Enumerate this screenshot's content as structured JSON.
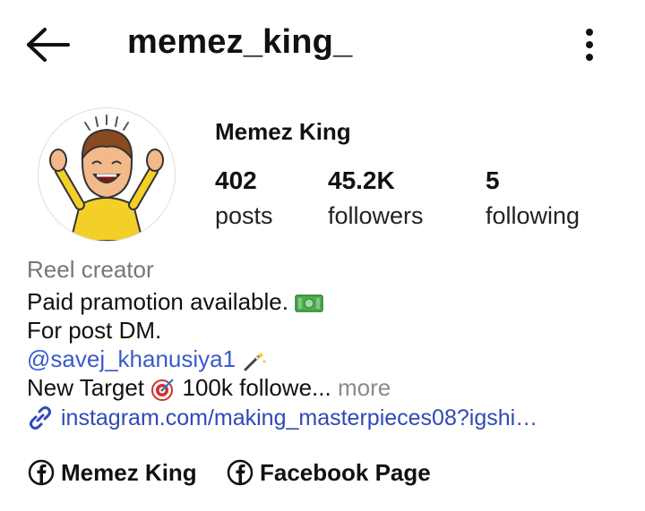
{
  "header": {
    "back_icon": "arrow-left-icon",
    "username": "memez_king_",
    "menu_icon": "more-vertical-icon"
  },
  "profile": {
    "display_name": "Memez King",
    "stats": [
      {
        "value": "402",
        "label": "posts"
      },
      {
        "value": "45.2K",
        "label": "followers"
      },
      {
        "value": "5",
        "label": "following"
      }
    ]
  },
  "bio": {
    "category": "Reel creator",
    "line1": "Paid pramotion available.",
    "line2": "For post DM.",
    "mention": "@savej_khanusiya1",
    "line4_prefix": "New Target",
    "line4_suffix": "100k followe...",
    "more_label": "more",
    "link": "instagram.com/making_masterpieces08?igshi…"
  },
  "linked_pages": [
    {
      "label": "Memez King",
      "icon": "facebook-icon"
    },
    {
      "label": "Facebook Page",
      "icon": "facebook-icon"
    }
  ],
  "colors": {
    "link_blue": "#2f49b8",
    "mention_blue": "#3a5bcc",
    "muted_gray": "#777777"
  }
}
